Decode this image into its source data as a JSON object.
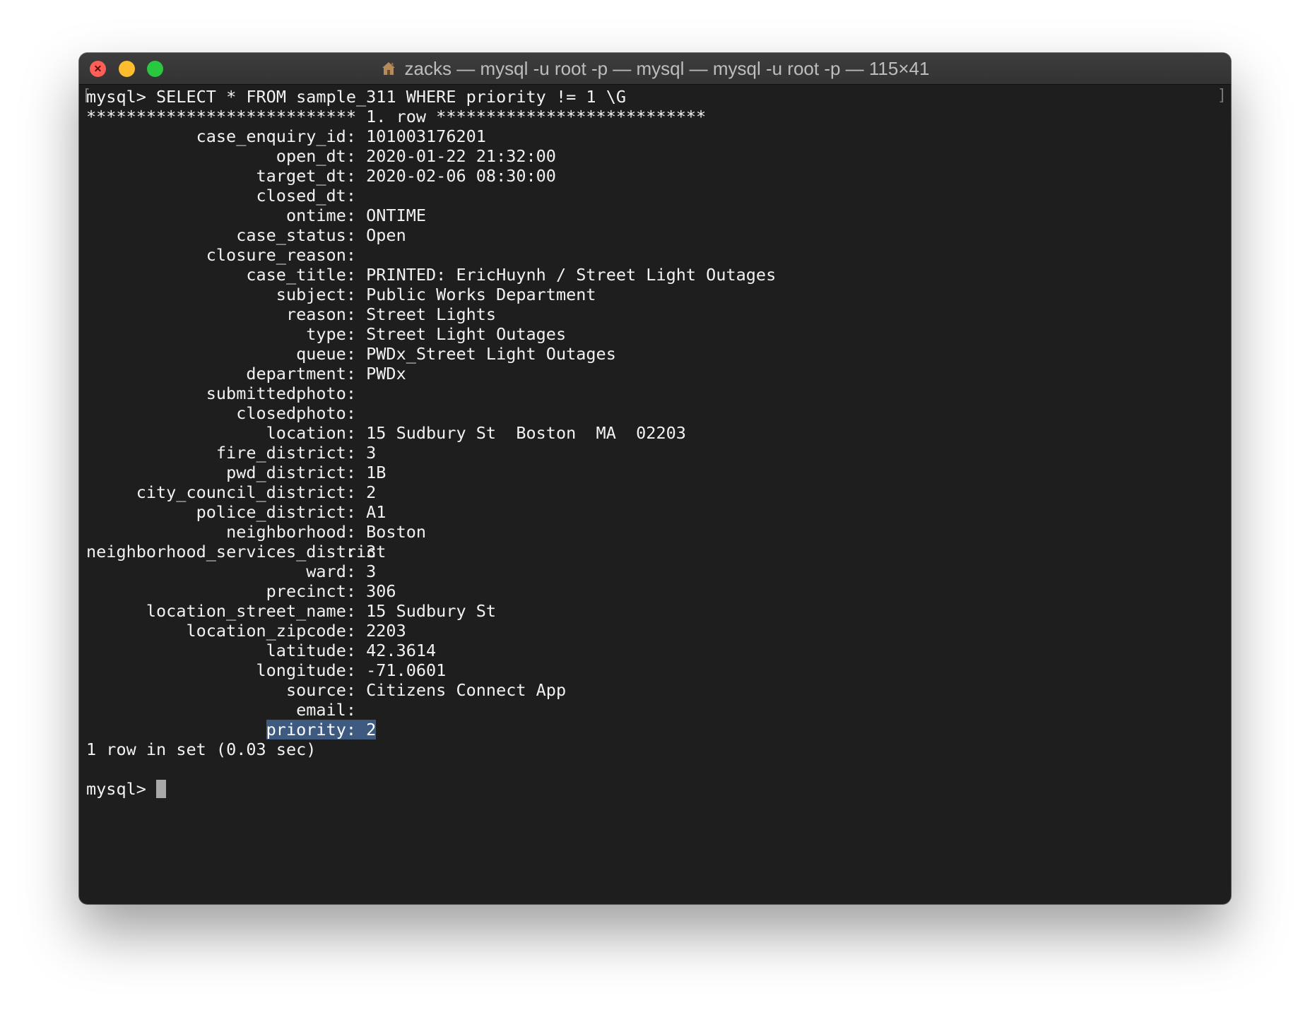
{
  "window": {
    "title": "zacks — mysql -u root -p — mysql — mysql -u root -p — 115×41",
    "title_icon": "home-icon",
    "traffic_lights": {
      "close_color": "#ff5f57",
      "minimize_color": "#febc2e",
      "maximize_color": "#28c840"
    }
  },
  "terminal": {
    "command": "mysql> SELECT * FROM sample_311 WHERE priority != 1 \\G",
    "row_header": "*************************** 1. row ***************************",
    "fields": [
      {
        "name": "case_enquiry_id",
        "value": "101003176201"
      },
      {
        "name": "open_dt",
        "value": "2020-01-22 21:32:00"
      },
      {
        "name": "target_dt",
        "value": "2020-02-06 08:30:00"
      },
      {
        "name": "closed_dt",
        "value": ""
      },
      {
        "name": "ontime",
        "value": "ONTIME"
      },
      {
        "name": "case_status",
        "value": "Open"
      },
      {
        "name": "closure_reason",
        "value": ""
      },
      {
        "name": "case_title",
        "value": "PRINTED: EricHuynh / Street Light Outages"
      },
      {
        "name": "subject",
        "value": "Public Works Department"
      },
      {
        "name": "reason",
        "value": "Street Lights"
      },
      {
        "name": "type",
        "value": "Street Light Outages"
      },
      {
        "name": "queue",
        "value": "PWDx_Street Light Outages"
      },
      {
        "name": "department",
        "value": "PWDx"
      },
      {
        "name": "submittedphoto",
        "value": ""
      },
      {
        "name": "closedphoto",
        "value": ""
      },
      {
        "name": "location",
        "value": "15 Sudbury St  Boston  MA  02203"
      },
      {
        "name": "fire_district",
        "value": "3"
      },
      {
        "name": "pwd_district",
        "value": "1B"
      },
      {
        "name": "city_council_district",
        "value": "2"
      },
      {
        "name": "police_district",
        "value": "A1"
      },
      {
        "name": "neighborhood",
        "value": "Boston"
      },
      {
        "name": "neighborhood_services_district",
        "value": "3"
      },
      {
        "name": "ward",
        "value": "3"
      },
      {
        "name": "precinct",
        "value": "306"
      },
      {
        "name": "location_street_name",
        "value": "15 Sudbury St"
      },
      {
        "name": "location_zipcode",
        "value": "2203"
      },
      {
        "name": "latitude",
        "value": "42.3614"
      },
      {
        "name": "longitude",
        "value": "-71.0601"
      },
      {
        "name": "source",
        "value": "Citizens Connect App"
      },
      {
        "name": "email",
        "value": ""
      },
      {
        "name": "priority",
        "value": "2",
        "highlighted": true
      }
    ],
    "result_summary": "1 row in set (0.03 sec)",
    "prompt": "mysql> ",
    "colors": {
      "background": "#1e1e1e",
      "foreground": "#f2f2f2",
      "selection": "#3e5a80"
    }
  }
}
